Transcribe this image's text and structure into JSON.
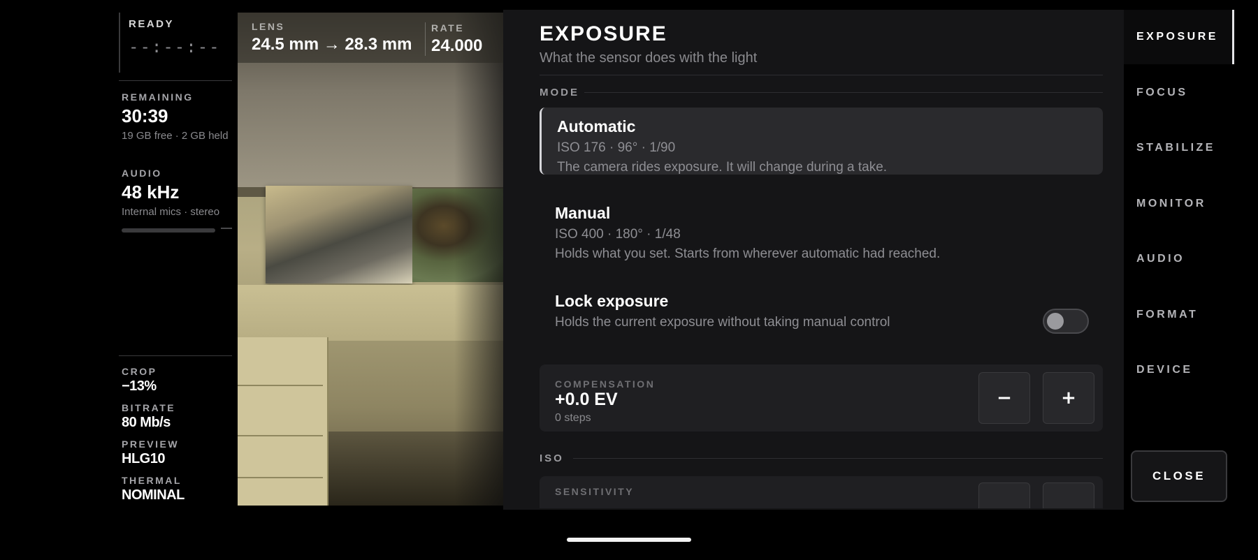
{
  "status": {
    "ready_label": "READY",
    "timecode": "--:--:--",
    "remaining": {
      "label": "REMAINING",
      "value": "30:39",
      "detail": "19 GB free · 2 GB held"
    },
    "audio": {
      "label": "AUDIO",
      "value": "48 kHz",
      "detail": "Internal mics · stereo",
      "meter_end": "—"
    },
    "crop": {
      "label": "CROP",
      "value": "−13%"
    },
    "bitrate": {
      "label": "BITRATE",
      "value": "80 Mb/s"
    },
    "preview": {
      "label": "PREVIEW",
      "value": "HLG10"
    },
    "thermal": {
      "label": "THERMAL",
      "value": "NOMINAL"
    }
  },
  "viewfinder": {
    "lens": {
      "label": "LENS",
      "value": "24.5 mm → 28.3 mm"
    },
    "rate": {
      "label": "RATE",
      "value": "24.000"
    }
  },
  "sheet": {
    "title": "EXPOSURE",
    "subtitle": "What the sensor does with the light",
    "mode_section": "MODE",
    "options": [
      {
        "title": "Automatic",
        "settings": "ISO 176 · 96° · 1/90",
        "description": "The camera rides exposure. It will change during a take.",
        "selected": true
      },
      {
        "title": "Manual",
        "settings": "ISO 400 · 180° · 1/48",
        "description": "Holds what you set. Starts from wherever automatic had reached.",
        "selected": false
      }
    ],
    "lock": {
      "title": "Lock exposure",
      "description": "Holds the current exposure without taking manual control",
      "enabled": false
    },
    "compensation": {
      "label": "COMPENSATION",
      "value": "+0.0 EV",
      "detail": "0 steps",
      "minus": "−",
      "plus": "+"
    },
    "iso_section": "ISO",
    "sensitivity": {
      "label": "SENSITIVITY"
    }
  },
  "tabs": [
    "EXPOSURE",
    "FOCUS",
    "STABILIZE",
    "MONITOR",
    "AUDIO",
    "FORMAT",
    "DEVICE"
  ],
  "active_tab": "EXPOSURE",
  "close_label": "CLOSE"
}
